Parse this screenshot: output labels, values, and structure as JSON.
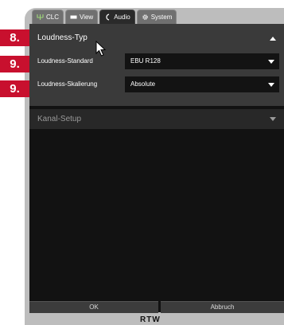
{
  "tabs": [
    {
      "label": "CLC",
      "icon": "routing-icon"
    },
    {
      "label": "View",
      "icon": "display-icon"
    },
    {
      "label": "Audio",
      "icon": "waveform-icon"
    },
    {
      "label": "System",
      "icon": "gear-icon"
    }
  ],
  "active_tab": "Audio",
  "section": {
    "title": "Loudness-Typ",
    "expanded": true
  },
  "settings": {
    "standard": {
      "label": "Loudness-Standard",
      "value": "EBU R128"
    },
    "scaling": {
      "label": "Loudness-Skalierung",
      "value": "Absolute"
    }
  },
  "kanal_setup": {
    "title": "Kanal-Setup",
    "expanded": false
  },
  "buttons": {
    "ok": "OK",
    "cancel": "Abbruch"
  },
  "logo": "RTW",
  "badges": [
    "8.",
    "9.",
    "9."
  ],
  "colors": {
    "badge": "#c8102e",
    "panel": "#3a3a3a",
    "screen": "#121212"
  }
}
